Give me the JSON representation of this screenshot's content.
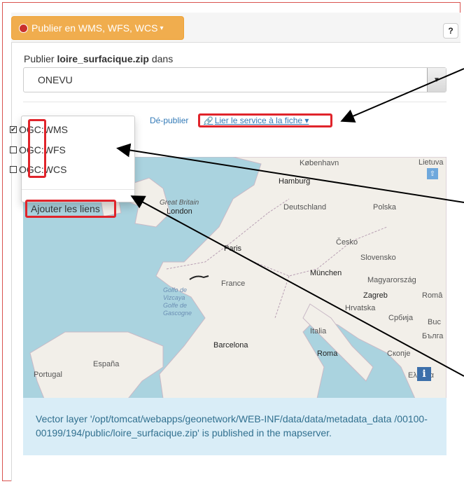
{
  "toolbar": {
    "publish_button_label": "Publier en WMS, WFS, WCS",
    "help_label": "?"
  },
  "form": {
    "publish_prefix": "Publier ",
    "file_name": "loire_surfacique.zip",
    "publish_suffix": " dans",
    "selected_server": "ONEVU"
  },
  "actions": {
    "unpublish": "Dé-publier",
    "link_service": "Lier le service à la fiche"
  },
  "dropdown": {
    "options": [
      {
        "label": "OGC:WMS",
        "checked": true
      },
      {
        "label": "OGC:WFS",
        "checked": false
      },
      {
        "label": "OGC:WCS",
        "checked": false
      }
    ],
    "add_links": "Ajouter les liens"
  },
  "map": {
    "labels": {
      "kobenhavn": "København",
      "lietuva": "Lietuva",
      "hamburg": "Hamburg",
      "great_britain": "Great Britain",
      "london": "London",
      "deutschland": "Deutschland",
      "polska": "Polska",
      "paris": "Paris",
      "cesko": "Česko",
      "slovensko": "Slovensko",
      "munchen": "München",
      "france": "France",
      "magyarorszag": "Magyarország",
      "golfo": "Golfo de Vizcaya Golfe de Gascogne",
      "zagreb": "Zagreb",
      "roma_label": "Româ",
      "hrvatska": "Hrvatska",
      "srbija": "Србија",
      "buc": "Buc",
      "italia": "Italia",
      "bulgaria": "Бълга",
      "barcelona": "Barcelona",
      "roma": "Roma",
      "skopje": "Скопје",
      "espana": "España",
      "portugal": "Portugal",
      "ellada": "Ελλάδα"
    },
    "info_label": "i",
    "scroll_label": "⇧"
  },
  "alert": {
    "message": "Vector layer '/opt/tomcat/webapps/geonetwork/WEB-INF/data/data/metadata_data /00100-00199/194/public/loire_surfacique.zip' is published in the mapserver."
  },
  "colors": {
    "warning": "#f0ad4e",
    "highlight": "#e0242b",
    "link": "#337ab7",
    "info_bg": "#d9edf7",
    "info_text": "#31708f"
  }
}
